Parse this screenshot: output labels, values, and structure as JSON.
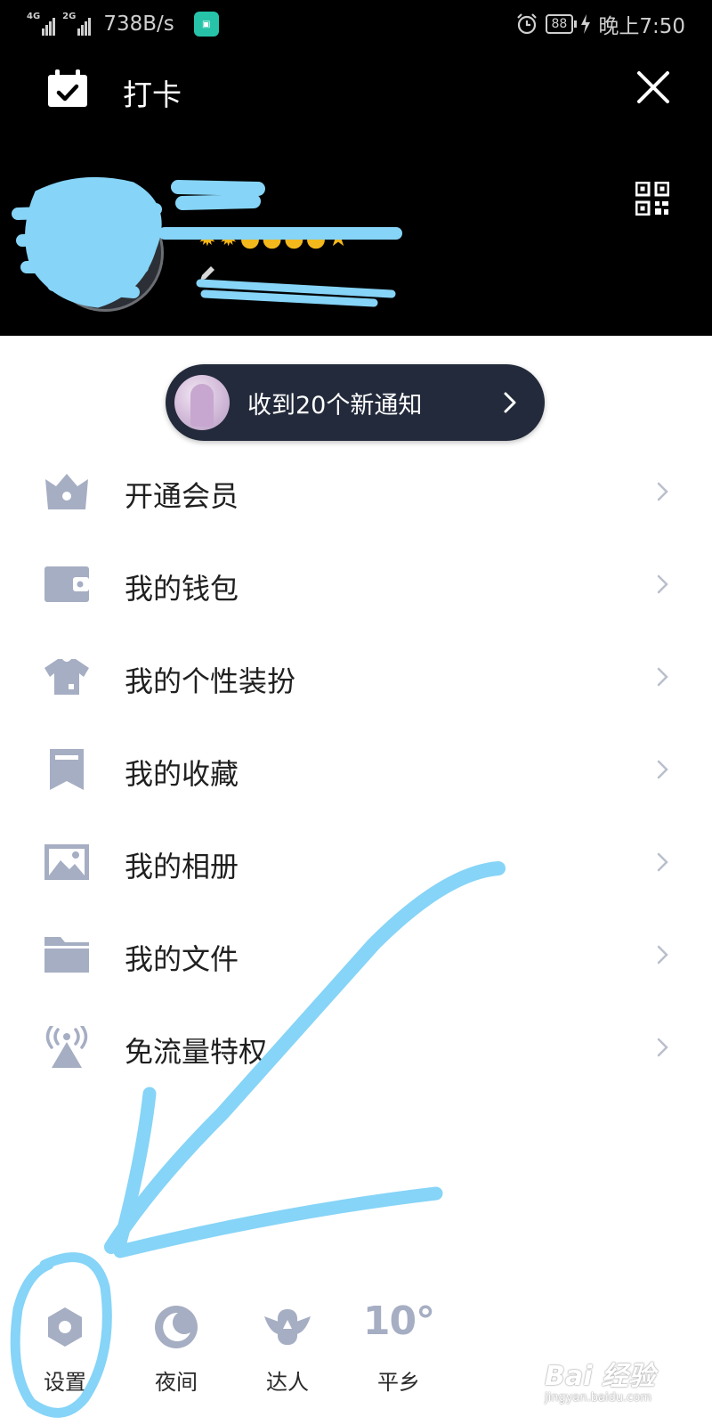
{
  "status_bar": {
    "network_1": "4G",
    "network_2": "2G",
    "speed": "738B/s",
    "battery": "88",
    "time": "晚上7:50"
  },
  "header": {
    "checkin_label": "打卡",
    "close_icon": "close-icon",
    "qr_icon": "qr-code-icon"
  },
  "notification": {
    "text": "收到20个新通知"
  },
  "menu": {
    "items": [
      {
        "label": "开通会员",
        "icon": "crown-icon"
      },
      {
        "label": "我的钱包",
        "icon": "wallet-icon"
      },
      {
        "label": "我的个性装扮",
        "icon": "tshirt-icon"
      },
      {
        "label": "我的收藏",
        "icon": "bookmark-icon"
      },
      {
        "label": "我的相册",
        "icon": "photo-icon"
      },
      {
        "label": "我的文件",
        "icon": "folder-icon"
      },
      {
        "label": "免流量特权",
        "icon": "broadcast-icon"
      }
    ]
  },
  "bottom_bar": {
    "settings_label": "设置",
    "night_label": "夜间",
    "expert_label": "达人",
    "weather_temp": "10°",
    "weather_city": "平乡"
  },
  "colors": {
    "header_bg": "#000000",
    "pill_bg": "#232a3b",
    "icon_gray": "#a6aec3",
    "annotation_blue": "#86d4f7"
  },
  "watermark": {
    "main": "Bai 经验",
    "sub": "jingyan.baidu.com"
  }
}
